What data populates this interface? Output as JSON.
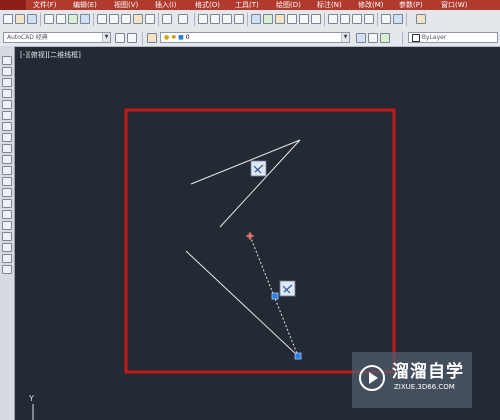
{
  "menu": {
    "items": [
      "文件(F)",
      "编辑(E)",
      "视图(V)",
      "插入(I)",
      "格式(O)",
      "工具(T)",
      "绘图(D)",
      "标注(N)",
      "修改(M)",
      "参数(P)",
      "窗口(W)"
    ]
  },
  "toolbar": {
    "workspace": "AutoCAD 经典",
    "layer_value": "0",
    "linetype_value": "ByLayer"
  },
  "viewport": {
    "label": "[-][俯视][二维线框]",
    "ucs_label": "Y"
  },
  "watermark": {
    "title": "溜溜自学",
    "url": "ZIXUE.3D66.COM"
  },
  "colors": {
    "canvas": "#232a33",
    "frame": "#c4191a",
    "lines": "#e8e8e8",
    "grip": "#2f7fe0",
    "center": "#c0392b"
  }
}
